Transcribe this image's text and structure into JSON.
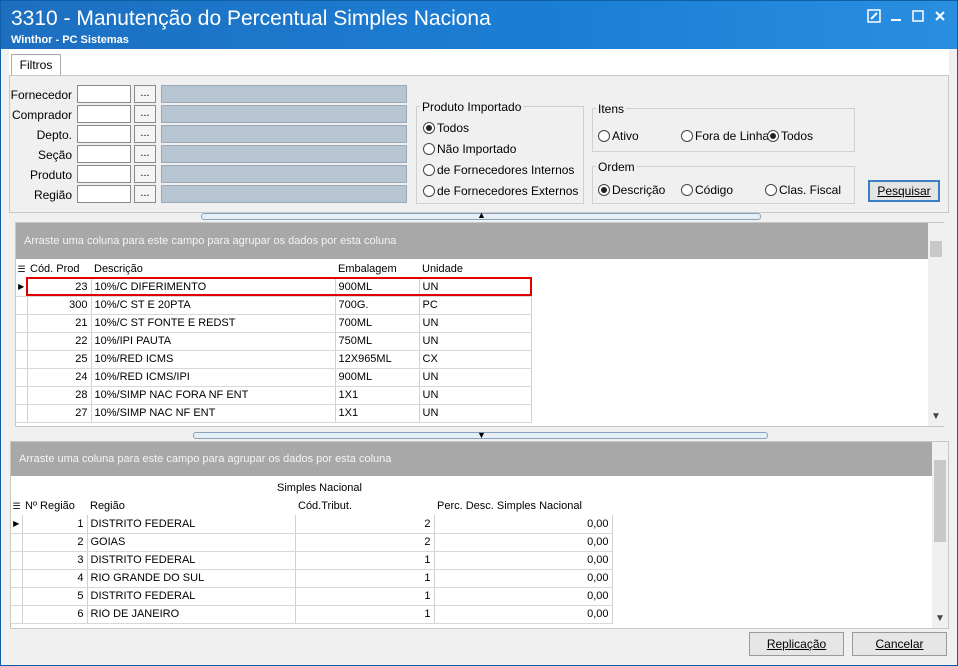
{
  "window": {
    "title": "3310 - Manutenção do Percentual Simples Naciona",
    "subtitle": "Winthor - PC Sistemas"
  },
  "tabs": [
    {
      "label": "Filtros"
    }
  ],
  "filters": {
    "fields": [
      {
        "label": "Fornecedor",
        "value": "",
        "desc": ""
      },
      {
        "label": "Comprador",
        "value": "",
        "desc": ""
      },
      {
        "label": "Depto.",
        "value": "",
        "desc": ""
      },
      {
        "label": "Seção",
        "value": "",
        "desc": ""
      },
      {
        "label": "Produto",
        "value": "",
        "desc": ""
      },
      {
        "label": "Região",
        "value": "",
        "desc": ""
      }
    ],
    "browse_label": "...",
    "produto_importado": {
      "title": "Produto Importado",
      "options": [
        "Todos",
        "Não Importado",
        "de Fornecedores Internos",
        "de Fornecedores Externos"
      ],
      "selected": "Todos"
    },
    "itens": {
      "title": "Itens",
      "options": [
        "Ativo",
        "Fora de Linha",
        "Todos"
      ],
      "selected": "Todos"
    },
    "ordem": {
      "title": "Ordem",
      "options": [
        "Descrição",
        "Código",
        "Clas. Fiscal"
      ],
      "selected": "Descrição"
    },
    "search_button": "Pesquisar"
  },
  "grid1": {
    "group_hint": "Arraste uma coluna para este campo para agrupar os dados por esta coluna",
    "columns": [
      "Cód. Prod",
      "Descrição",
      "Embalagem",
      "Unidade"
    ],
    "rows": [
      [
        "23",
        "10%/C DIFERIMENTO",
        "900ML",
        "UN"
      ],
      [
        "300",
        "10%/C ST E 20PTA",
        "700G.",
        "PC"
      ],
      [
        "21",
        "10%/C ST FONTE E REDST",
        "700ML",
        "UN"
      ],
      [
        "22",
        "10%/IPI PAUTA",
        "750ML",
        "UN"
      ],
      [
        "25",
        "10%/RED ICMS",
        "12X965ML",
        "CX"
      ],
      [
        "24",
        "10%/RED ICMS/IPI",
        "900ML",
        "UN"
      ],
      [
        "28",
        "10%/SIMP NAC FORA NF ENT",
        "1X1",
        "UN"
      ],
      [
        "27",
        "10%/SIMP NAC NF ENT",
        "1X1",
        "UN"
      ]
    ]
  },
  "grid2": {
    "group_hint": "Arraste uma coluna para este campo para agrupar os dados por esta coluna",
    "band": "Simples Nacional",
    "columns": [
      "Nº Região",
      "Região",
      "Cód.Tribut.",
      "Perc. Desc. Simples Nacional"
    ],
    "rows": [
      [
        "1",
        "DISTRITO FEDERAL",
        "2",
        "0,00"
      ],
      [
        "2",
        "GOIAS",
        "2",
        "0,00"
      ],
      [
        "3",
        "DISTRITO FEDERAL",
        "1",
        "0,00"
      ],
      [
        "4",
        "RIO GRANDE DO SUL",
        "1",
        "0,00"
      ],
      [
        "5",
        "DISTRITO FEDERAL",
        "1",
        "0,00"
      ],
      [
        "6",
        "RIO DE JANEIRO",
        "1",
        "0,00"
      ]
    ]
  },
  "footer": {
    "replicate": "Replicação",
    "cancel": "Cancelar"
  }
}
